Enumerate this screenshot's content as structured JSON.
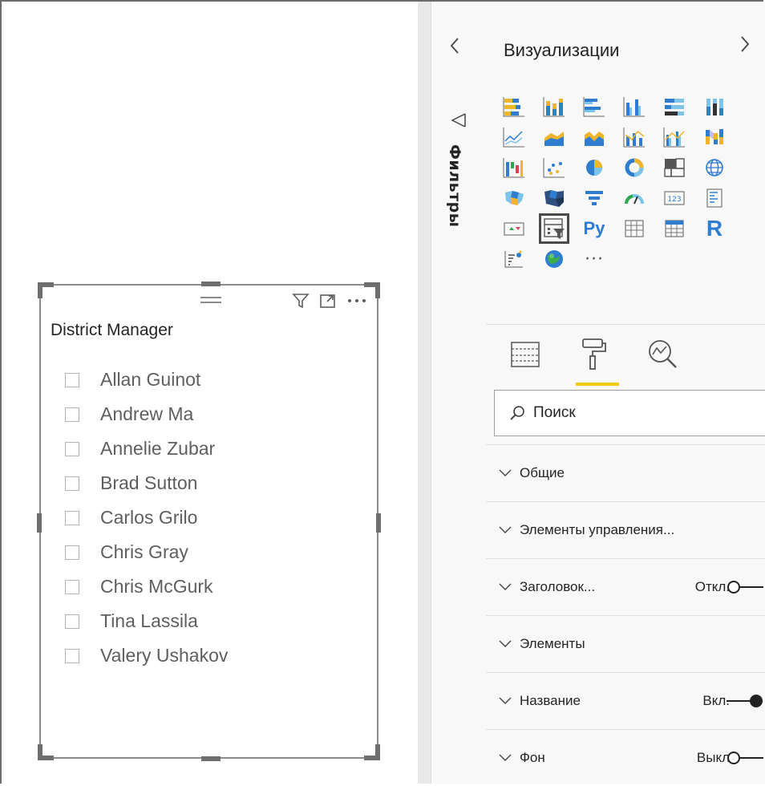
{
  "slicer": {
    "title": "District Manager",
    "items": [
      {
        "label": "Allan Guinot"
      },
      {
        "label": "Andrew Ma"
      },
      {
        "label": "Annelie Zubar"
      },
      {
        "label": "Brad Sutton"
      },
      {
        "label": "Carlos Grilo"
      },
      {
        "label": "Chris Gray"
      },
      {
        "label": "Chris McGurk"
      },
      {
        "label": "Tina Lassila"
      },
      {
        "label": "Valery Ushakov"
      }
    ],
    "header_icons": [
      "drag-grip-icon",
      "filter-icon",
      "focus-mode-icon",
      "more-options-icon"
    ]
  },
  "filters_pane": {
    "label": "Фильтры",
    "collapse_icon": "chevron-left-icon"
  },
  "viz_pane": {
    "title": "Визуализации",
    "expand_icon": "chevron-right-icon",
    "visuals": [
      "stacked-bar-chart",
      "stacked-column-chart",
      "clustered-bar-chart",
      "clustered-column-chart",
      "100-stacked-bar-chart",
      "100-stacked-column-chart",
      "line-chart",
      "area-chart",
      "stacked-area-chart",
      "line-and-stacked-column-chart",
      "line-and-clustered-column-chart",
      "ribbon-chart",
      "waterfall-chart",
      "scatter-chart",
      "pie-chart",
      "donut-chart",
      "treemap",
      "map",
      "filled-map",
      "shape-map",
      "funnel",
      "gauge",
      "card",
      "multi-row-card",
      "kpi",
      "slicer",
      "python-visual",
      "table",
      "matrix",
      "r-script-visual",
      "key-influencers",
      "arcgis-map",
      "more-visuals"
    ],
    "python_label": "Py",
    "r_label": "R",
    "more_label": "···",
    "selected_visual": "slicer",
    "tabs": [
      "fields-tab",
      "format-tab",
      "analytics-tab"
    ],
    "active_tab": "format-tab",
    "search": {
      "placeholder": "Поиск"
    },
    "sections": [
      {
        "label": "Общие"
      },
      {
        "label": "Элементы управления..."
      },
      {
        "label": "Заголовок...",
        "state": "Откл.",
        "on": false
      },
      {
        "label": "Элементы"
      },
      {
        "label": "Название",
        "state": "Вкл.",
        "on": true
      },
      {
        "label": "Фон",
        "state": "Выкл",
        "on": false
      }
    ]
  },
  "colors": {
    "accent_yellow": "#f2c811",
    "powerbi_blue": "#2f7dd1",
    "slicer_border": "#8c8c8c",
    "pane_bg": "#f8f8f8"
  }
}
